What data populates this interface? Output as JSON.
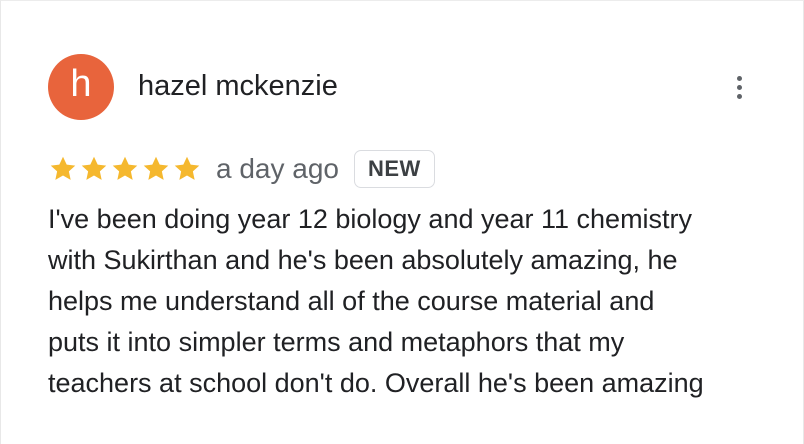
{
  "review": {
    "avatar_letter": "h",
    "avatar_color": "#e8643c",
    "reviewer_name": "hazel mckenzie",
    "more_options_icon": "more-vert-icon",
    "rating": 5,
    "rating_max": 5,
    "star_color": "#f5b82e",
    "date": "a day ago",
    "badge": "NEW",
    "text_lines": [
      "I've been doing year 12 biology and year 11 chemistry",
      "with Sukirthan and he's been absolutely amazing, he",
      "helps me understand all of the course material and",
      "puts it into simpler terms and metaphors that my",
      "teachers at school don't do. Overall he's been amazing"
    ]
  }
}
